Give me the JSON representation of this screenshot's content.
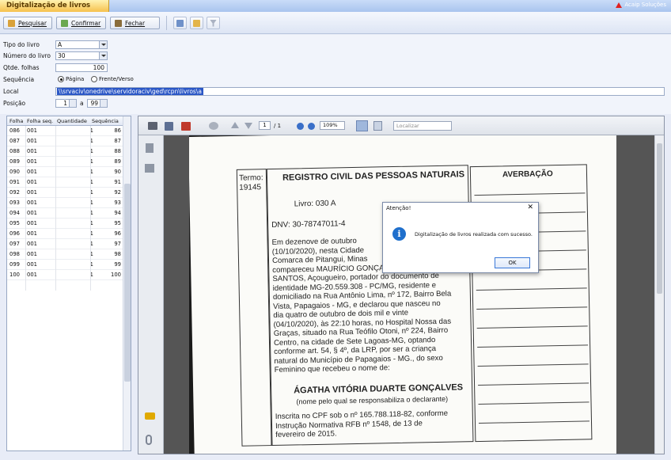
{
  "window": {
    "title": "Digitalização de livros",
    "brand": "Acaip Soluções"
  },
  "toolbar": {
    "search": "Pesquisar",
    "confirm": "Confirmar",
    "close": "Fechar"
  },
  "form": {
    "tipo_label": "Tipo do livro",
    "tipo_value": "A",
    "numero_label": "Número do livro",
    "numero_value": "30",
    "qtde_label": "Qtde. folhas",
    "qtde_value": "100",
    "sequencia_label": "Sequência",
    "opt_pagina": "Página",
    "opt_frente": "Frente/Verso",
    "selected": "Página",
    "local_label": "Local",
    "local_value": "\\\\srvaciv\\onedrive\\servidoraciv\\ged\\rcpn\\livros\\a",
    "posicao_label": "Posição",
    "pos_from": "1",
    "pos_sep": "a",
    "pos_to": "99"
  },
  "table": {
    "columns": [
      "Folha",
      "Folha seq.",
      "Quantidade",
      "Sequência"
    ],
    "rows": [
      [
        "086",
        "001",
        "1",
        "86"
      ],
      [
        "087",
        "001",
        "1",
        "87"
      ],
      [
        "088",
        "001",
        "1",
        "88"
      ],
      [
        "089",
        "001",
        "1",
        "89"
      ],
      [
        "090",
        "001",
        "1",
        "90"
      ],
      [
        "091",
        "001",
        "1",
        "91"
      ],
      [
        "092",
        "001",
        "1",
        "92"
      ],
      [
        "093",
        "001",
        "1",
        "93"
      ],
      [
        "094",
        "001",
        "1",
        "94"
      ],
      [
        "095",
        "001",
        "1",
        "95"
      ],
      [
        "096",
        "001",
        "1",
        "96"
      ],
      [
        "097",
        "001",
        "1",
        "97"
      ],
      [
        "098",
        "001",
        "1",
        "98"
      ],
      [
        "099",
        "001",
        "1",
        "99"
      ],
      [
        "100",
        "001",
        "1",
        "100"
      ]
    ]
  },
  "pdf": {
    "page": "1",
    "page_total": "/ 1",
    "zoom": "109%",
    "find_placeholder": "Localizar"
  },
  "document": {
    "termo": "Termo:",
    "termo_num": "19145",
    "heading": "REGISTRO CIVIL DAS PESSOAS NATURAIS",
    "averbacao": "AVERBAÇÃO",
    "livro": "Livro: 030 A",
    "dnv": "DNV: 30-78747011-4",
    "body": [
      "Em dezenove de outubro",
      "(10/10/2020), nesta Cidade",
      "Comarca de Pitangui, Minas",
      "compareceu MAURÍCIO GONÇALVES DOS",
      "SANTOS, Açougueiro, portador do documento de",
      "identidade MG-20.559.308 - PC/MG, residente e",
      "domiciliado na Rua Antônio Lima, nº 172, Bairro Bela",
      "Vista, Papagaios - MG, e declarou que nasceu no",
      "dia quatro de outubro de dois mil e vinte",
      "(04/10/2020), às 22:10 horas, no Hospital Nossa das",
      "Graças, situado na Rua Teófilo Otoni, nº 224, Bairro",
      "Centro, na cidade de Sete Lagoas-MG, optando",
      "conforme art. 54, § 4º, da LRP, por ser a criança",
      "natural do Município de Papagaios - MG., do sexo",
      "Feminino que recebeu o nome de:"
    ],
    "child_name": "ÁGATHA VITÓRIA DUARTE GONÇALVES",
    "child_note": "(nome pelo qual se responsabiliza o declarante)",
    "footer": [
      "Inscrita no CPF sob o nº 165.788.118-82, conforme",
      "Instrução Normativa RFB nº 1548, de 13 de",
      "fevereiro de 2015."
    ]
  },
  "dialog": {
    "title": "Atenção!",
    "message": "Digitalização de livros realizada com sucesso.",
    "ok": "OK",
    "close": "✕"
  },
  "colors": {
    "accent": "#f6c14d",
    "selection": "#2a56c6",
    "info": "#1f6fcc"
  }
}
